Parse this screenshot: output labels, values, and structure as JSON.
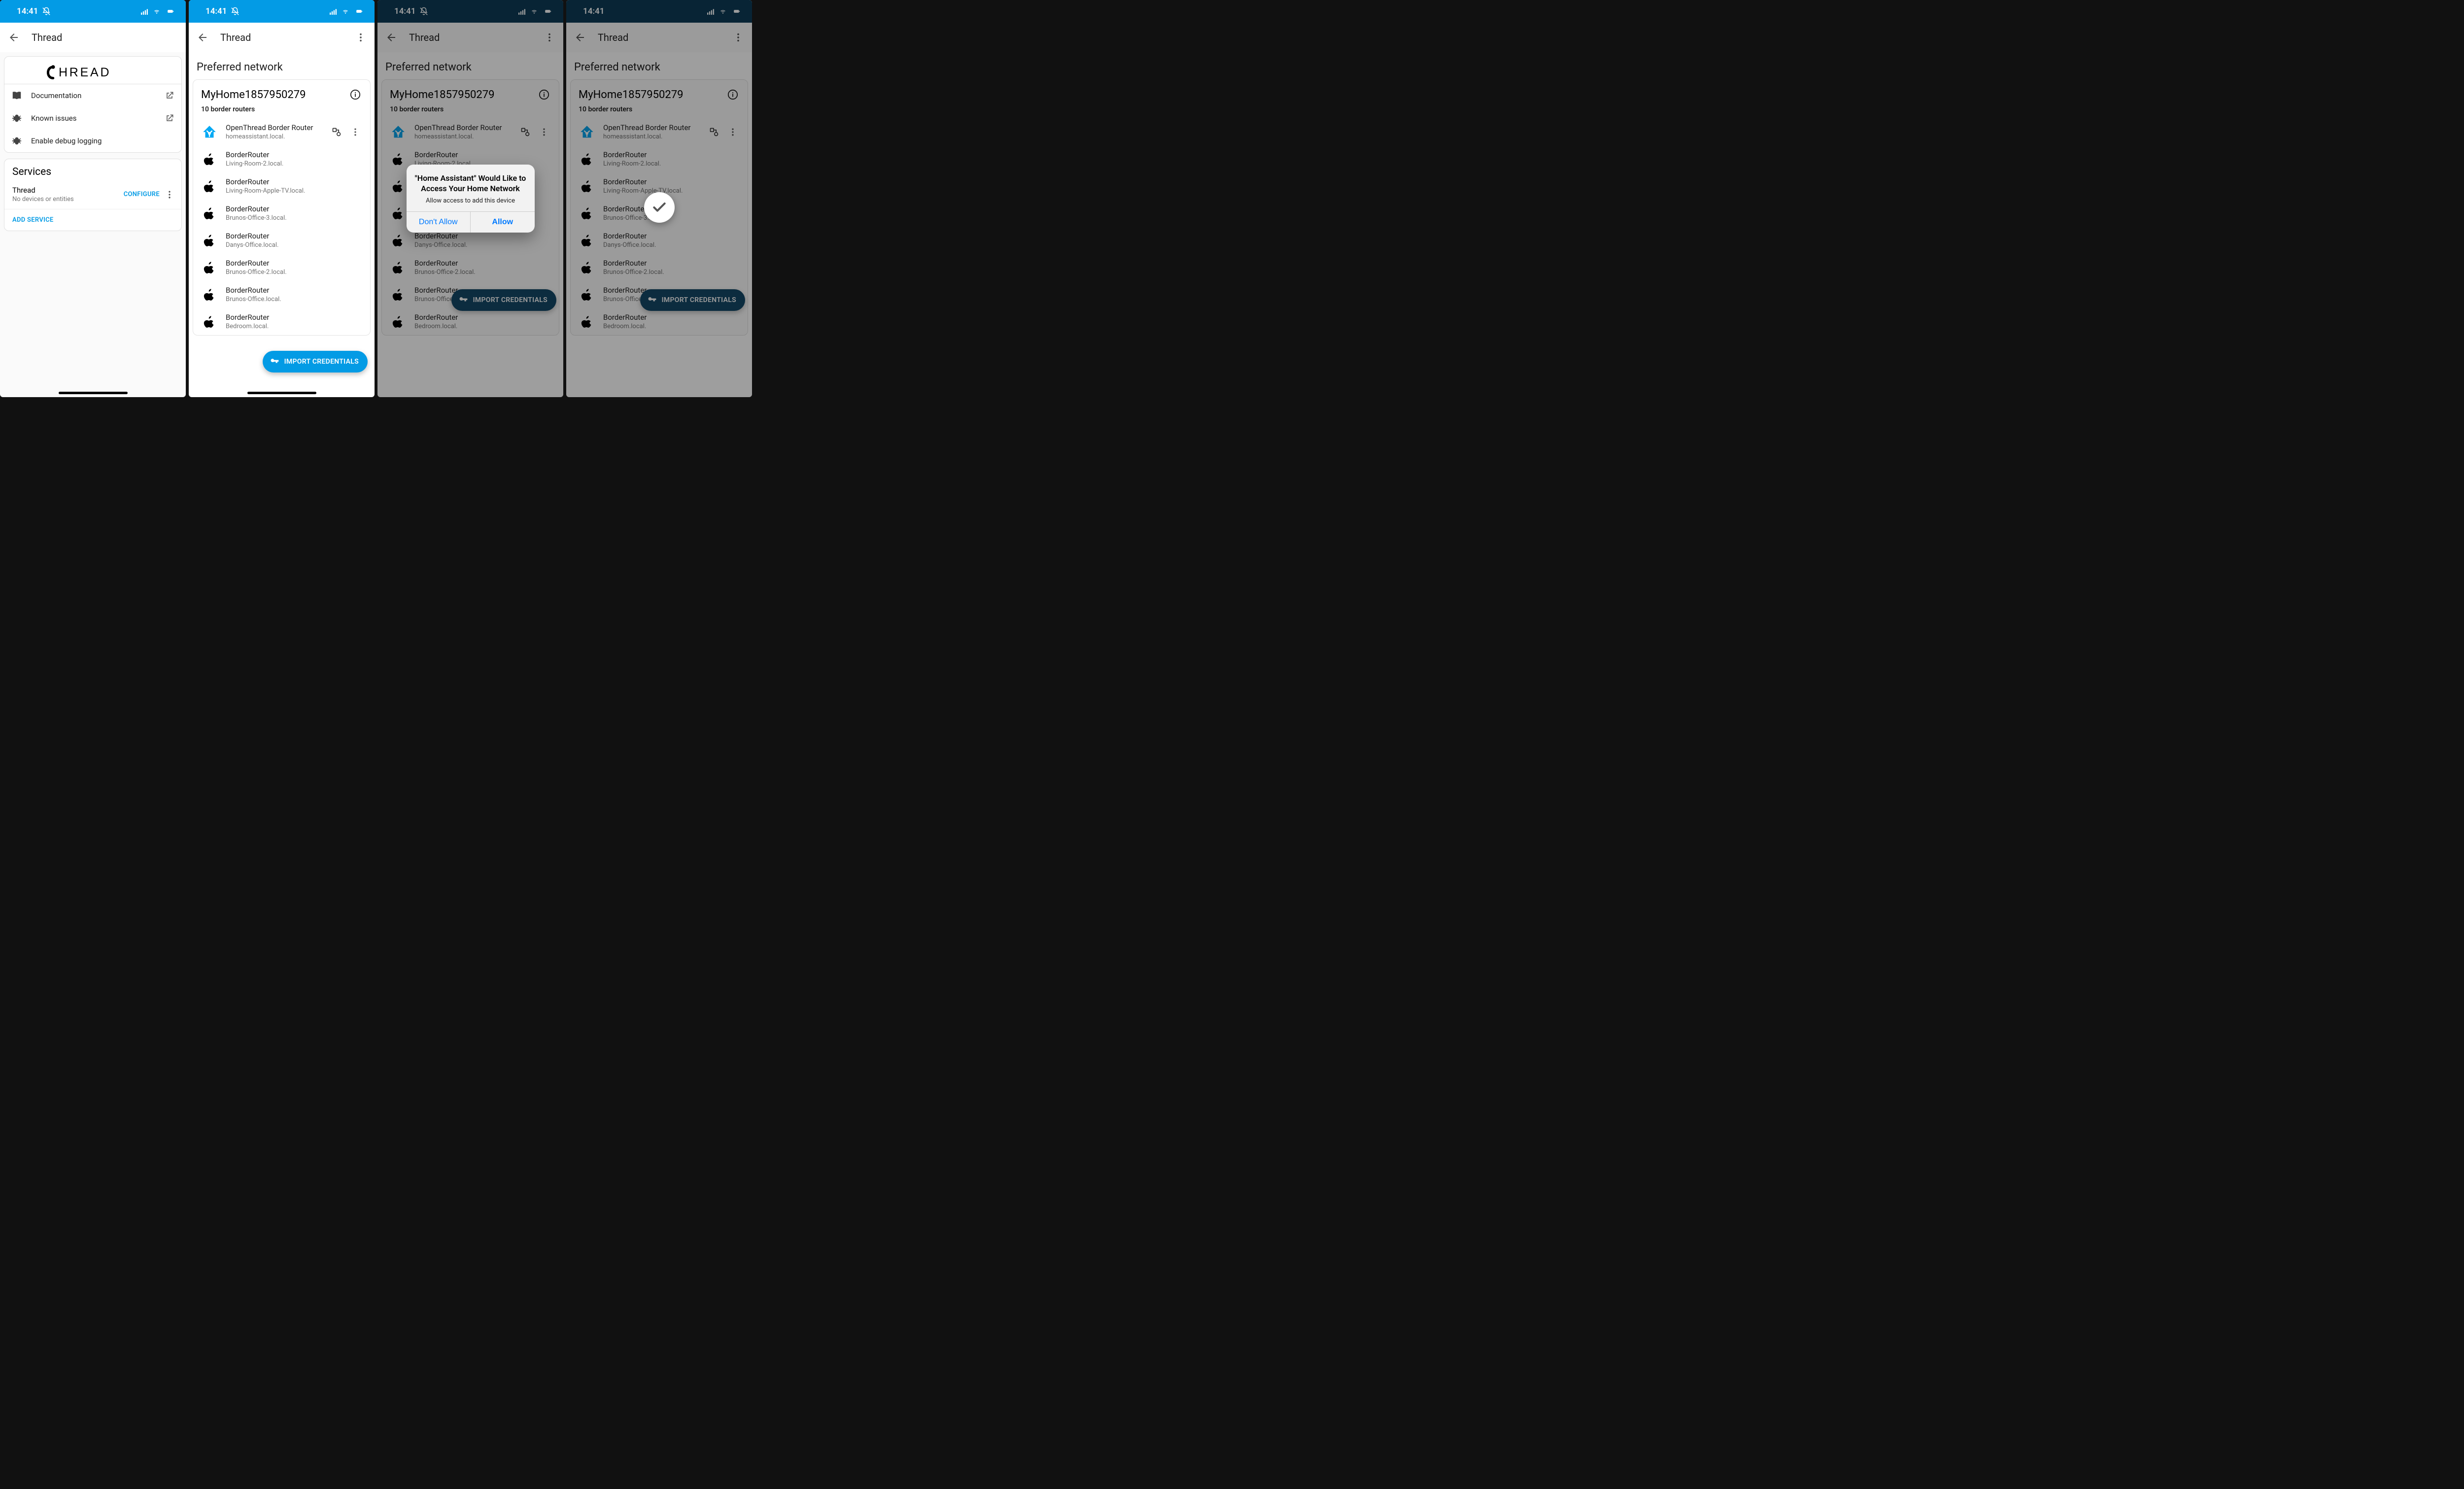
{
  "status": {
    "time": "14:41"
  },
  "screen1": {
    "title": "Thread",
    "logo_text": "THREAD",
    "links": {
      "documentation": "Documentation",
      "known_issues": "Known issues",
      "debug": "Enable debug logging"
    },
    "services": {
      "heading": "Services",
      "item_name": "Thread",
      "item_sub": "No devices or entities",
      "configure": "CONFIGURE",
      "add": "ADD SERVICE"
    }
  },
  "network": {
    "heading": "Preferred network",
    "name": "MyHome1857950279",
    "border_count": "10 border routers",
    "routers": [
      {
        "icon": "ha",
        "name": "OpenThread Border Router",
        "host": "homeassistant.local."
      },
      {
        "icon": "apple",
        "name": "BorderRouter",
        "host": "Living-Room-2.local."
      },
      {
        "icon": "apple",
        "name": "BorderRouter",
        "host": "Living-Room-Apple-TV.local."
      },
      {
        "icon": "apple",
        "name": "BorderRouter",
        "host": "Brunos-Office-3.local."
      },
      {
        "icon": "apple",
        "name": "BorderRouter",
        "host": "Danys-Office.local."
      },
      {
        "icon": "apple",
        "name": "BorderRouter",
        "host": "Brunos-Office-2.local."
      },
      {
        "icon": "apple",
        "name": "BorderRouter",
        "host": "Brunos-Office.local."
      },
      {
        "icon": "apple",
        "name": "BorderRouter",
        "host": "Bedroom.local."
      }
    ],
    "fab": "IMPORT CREDENTIALS"
  },
  "alert": {
    "title": "\"Home Assistant\" Would Like to Access Your Home Network",
    "message": "Allow access to add this device",
    "deny": "Don't Allow",
    "allow": "Allow"
  },
  "appbar_title": "Thread"
}
